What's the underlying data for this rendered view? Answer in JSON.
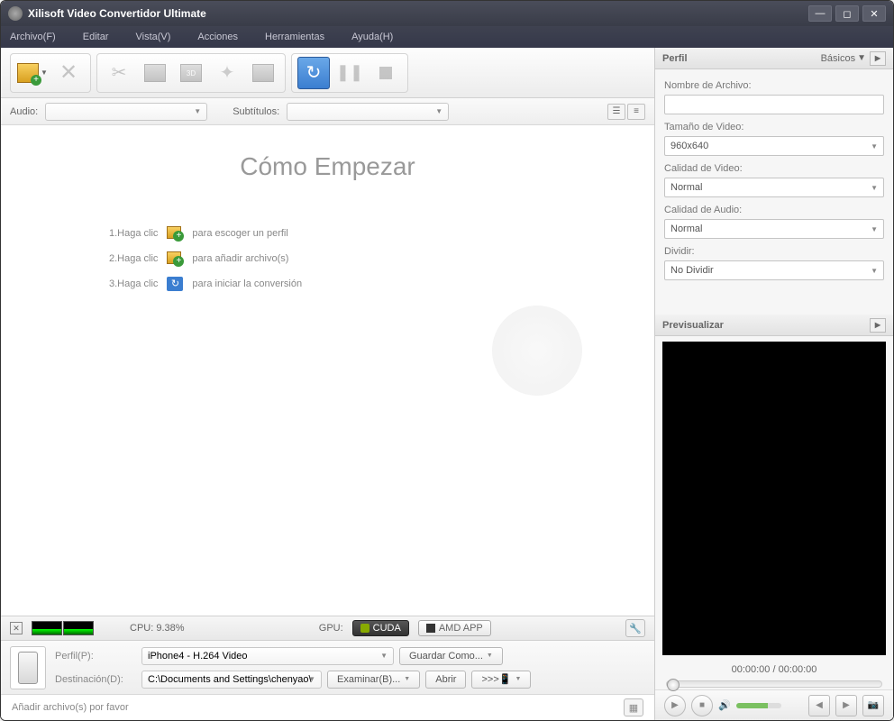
{
  "title": "Xilisoft Video Convertidor Ultimate",
  "menu": [
    "Archivo(F)",
    "Editar",
    "Vista(V)",
    "Acciones",
    "Herramientas",
    "Ayuda(H)"
  ],
  "selectrow": {
    "audio_label": "Audio:",
    "sub_label": "Subtítulos:"
  },
  "getting_started": {
    "title": "Cómo Empezar",
    "steps": [
      {
        "n": "1.Haga clic",
        "desc": "para escoger un perfil"
      },
      {
        "n": "2.Haga clic",
        "desc": "para añadir archivo(s)"
      },
      {
        "n": "3.Haga clic",
        "desc": "para iniciar la conversión"
      }
    ]
  },
  "cpu": {
    "label": "CPU: 9.38%",
    "gpu_label": "GPU:",
    "cuda": "CUDA",
    "amd": "AMD APP"
  },
  "profile": {
    "perfil_label": "Perfil(P):",
    "perfil_value": "iPhone4 - H.264 Video",
    "guardar": "Guardar Como...",
    "dest_label": "Destinación(D):",
    "dest_value": "C:\\Documents and Settings\\chenyao\\",
    "examinar": "Examinar(B)...",
    "abrir": "Abrir",
    "send": ">>>"
  },
  "status": "Añadir archivo(s) por favor",
  "sidebar": {
    "perfil_head": "Perfil",
    "basicos": "Básicos",
    "name_label": "Nombre de Archivo:",
    "size_label": "Tamaño de Video:",
    "size_value": "960x640",
    "vq_label": "Calidad de Video:",
    "vq_value": "Normal",
    "aq_label": "Calidad de Audio:",
    "aq_value": "Normal",
    "split_label": "Dividir:",
    "split_value": "No Dividir",
    "preview_head": "Previsualizar",
    "timecode": "00:00:00 / 00:00:00"
  }
}
